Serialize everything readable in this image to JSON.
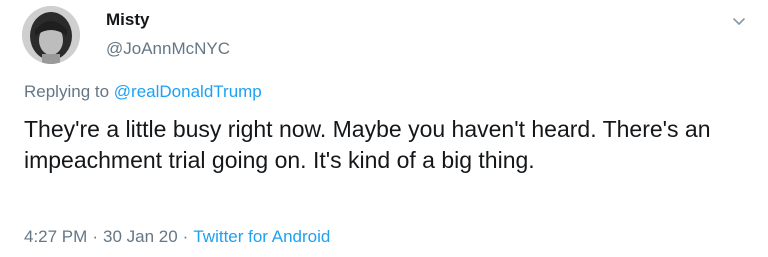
{
  "author": {
    "display_name": "Misty",
    "handle": "@JoAnnMcNYC",
    "avatar": "profile-photo"
  },
  "menu": {
    "icon": "chevron-down-icon"
  },
  "reply": {
    "prefix": "Replying to",
    "mention": "@realDonaldTrump"
  },
  "tweet": {
    "text": "They're a little busy right now. Maybe you haven't heard. There's an impeachment trial going on. It's kind of a big thing."
  },
  "meta": {
    "time": "4:27 PM",
    "separator": "·",
    "date": "30 Jan 20",
    "source": "Twitter for Android"
  },
  "colors": {
    "text": "#14171a",
    "secondary": "#657786",
    "link": "#1da1f2"
  }
}
